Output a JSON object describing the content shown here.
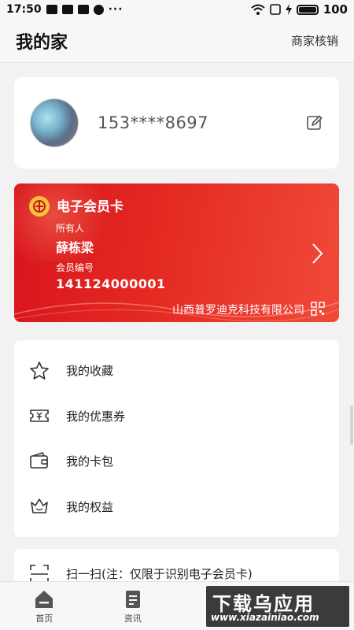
{
  "status_bar": {
    "time": "17:50",
    "dots": "···",
    "battery": "100"
  },
  "header": {
    "title": "我的家",
    "action": "商家核销"
  },
  "profile": {
    "phone": "153****8697"
  },
  "member_card": {
    "title": "电子会员卡",
    "owner_label": "所有人",
    "owner_name": "薛栋梁",
    "number_label": "会员编号",
    "number": "141124000001",
    "company": "山西普罗迪克科技有限公司"
  },
  "menu": [
    {
      "label": "我的收藏",
      "icon": "star-icon"
    },
    {
      "label": "我的优惠券",
      "icon": "coupon-icon"
    },
    {
      "label": "我的卡包",
      "icon": "wallet-icon"
    },
    {
      "label": "我的权益",
      "icon": "rights-icon"
    }
  ],
  "scan": {
    "label": "扫一扫(注：仅限于识别电子会员卡)"
  },
  "bottom_nav": [
    {
      "label": "首页",
      "icon": "home-icon"
    },
    {
      "label": "资讯",
      "icon": "news-icon"
    }
  ],
  "watermark": {
    "title": "下载乌应用",
    "url": "www.xiazainiao.com"
  },
  "colors": {
    "card_red": "#e42a23",
    "background": "#f2f2f2"
  }
}
